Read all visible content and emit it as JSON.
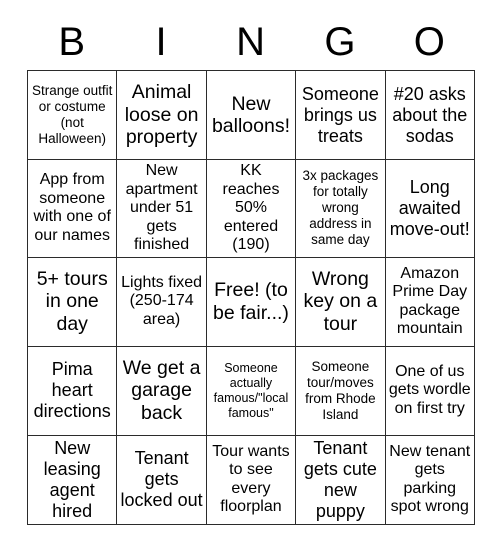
{
  "header": {
    "letters": [
      "B",
      "I",
      "N",
      "G",
      "O"
    ]
  },
  "grid": {
    "rows": 5,
    "cols": 5,
    "free_space": {
      "row": 2,
      "col": 2
    },
    "cells": [
      [
        {
          "text": "Strange outfit or costume (not Halloween)",
          "size": "fs-sm"
        },
        {
          "text": "Animal loose on property",
          "size": "fs-xl"
        },
        {
          "text": "New balloons!",
          "size": "fs-xl"
        },
        {
          "text": "Someone brings us treats",
          "size": "fs-lg"
        },
        {
          "text": "#20 asks about the sodas",
          "size": "fs-lg"
        }
      ],
      [
        {
          "text": "App from someone with one of our names",
          "size": "fs-md"
        },
        {
          "text": "New apartment under 51 gets finished",
          "size": "fs-md"
        },
        {
          "text": "KK reaches 50% entered (190)",
          "size": "fs-md"
        },
        {
          "text": "3x packages for totally wrong address in same day",
          "size": "fs-sm"
        },
        {
          "text": "Long awaited move-out!",
          "size": "fs-lg"
        }
      ],
      [
        {
          "text": "5+ tours in one day",
          "size": "fs-xl"
        },
        {
          "text": "Lights fixed (250-174 area)",
          "size": "fs-md"
        },
        {
          "text": "Free! (to be fair...)",
          "size": "fs-xl"
        },
        {
          "text": "Wrong key on a tour",
          "size": "fs-xl"
        },
        {
          "text": "Amazon Prime Day package mountain",
          "size": "fs-md"
        }
      ],
      [
        {
          "text": "Pima heart directions",
          "size": "fs-lg"
        },
        {
          "text": "We get a garage back",
          "size": "fs-xl"
        },
        {
          "text": "Someone actually famous/\"local famous\"",
          "size": "fs-xs"
        },
        {
          "text": "Someone tour/moves from Rhode Island",
          "size": "fs-sm"
        },
        {
          "text": "One of us gets wordle on first try",
          "size": "fs-md"
        }
      ],
      [
        {
          "text": "New leasing agent hired",
          "size": "fs-lg"
        },
        {
          "text": "Tenant gets locked out",
          "size": "fs-lg"
        },
        {
          "text": "Tour wants to see every floorplan",
          "size": "fs-md"
        },
        {
          "text": "Tenant gets cute new puppy",
          "size": "fs-lg"
        },
        {
          "text": "New tenant gets parking spot wrong",
          "size": "fs-md"
        }
      ]
    ]
  },
  "colors": {
    "border": "#2b2b2b",
    "text": "#000000",
    "background": "#ffffff"
  }
}
